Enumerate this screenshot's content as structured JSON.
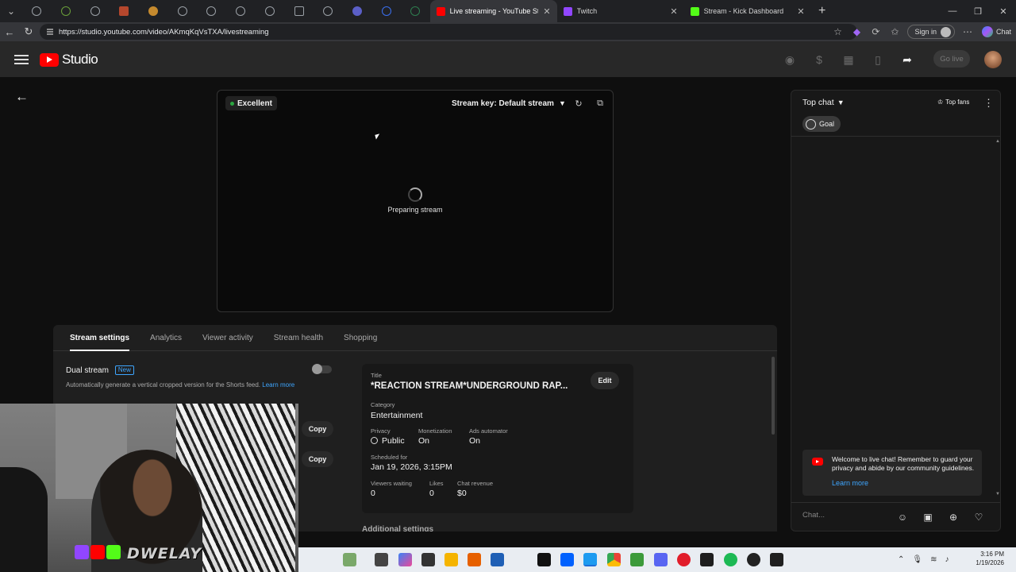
{
  "browser": {
    "tabs": [
      {
        "title": "Live streaming - YouTube Studio",
        "active": true,
        "favicon_color": "#ff0000"
      },
      {
        "title": "Twitch",
        "active": false,
        "favicon_color": "#9146ff"
      },
      {
        "title": "Stream - Kick Dashboard",
        "active": false,
        "favicon_color": "#53fc18"
      }
    ],
    "url": "https://studio.youtube.com/video/AKmqKqVsTXA/livestreaming",
    "signin_label": "Sign in",
    "chat_label": "Chat"
  },
  "studio": {
    "logo_text": "Studio",
    "go_live_label": "Go live"
  },
  "preview": {
    "status": "Excellent",
    "stream_key": "Stream key: Default stream",
    "loading_text": "Preparing stream"
  },
  "panel": {
    "tabs": [
      "Stream settings",
      "Analytics",
      "Viewer activity",
      "Stream health",
      "Shopping"
    ],
    "active_tab": "Stream settings",
    "dual_stream": {
      "title": "Dual stream",
      "badge": "New",
      "description": "Automatically generate a vertical cropped version for the Shorts feed.",
      "learn_more": "Learn more",
      "enabled": false
    },
    "copy_label": "Copy",
    "details": {
      "title_label": "Title",
      "title_value": "*REACTION STREAM*UNDERGROUND RAP...",
      "edit_label": "Edit",
      "category_label": "Category",
      "category_value": "Entertainment",
      "privacy_label": "Privacy",
      "privacy_value": "Public",
      "monetization_label": "Monetization",
      "monetization_value": "On",
      "ads_label": "Ads automator",
      "ads_value": "On",
      "scheduled_label": "Scheduled for",
      "scheduled_value": "Jan 19, 2026, 3:15PM",
      "viewers_label": "Viewers waiting",
      "viewers_value": "0",
      "likes_label": "Likes",
      "likes_value": "0",
      "revenue_label": "Chat revenue",
      "revenue_value": "$0"
    },
    "additional": "Additional settings"
  },
  "chat": {
    "mode": "Top chat",
    "top_fans": "Top fans",
    "goal": "Goal",
    "welcome": "Welcome to live chat! Remember to guard your privacy and abide by our community guidelines.",
    "learn_more": "Learn more",
    "placeholder": "Chat..."
  },
  "overlay": {
    "name": "DWELAY"
  },
  "taskbar": {
    "time": "3:16 PM",
    "date": "1/19/2026"
  }
}
